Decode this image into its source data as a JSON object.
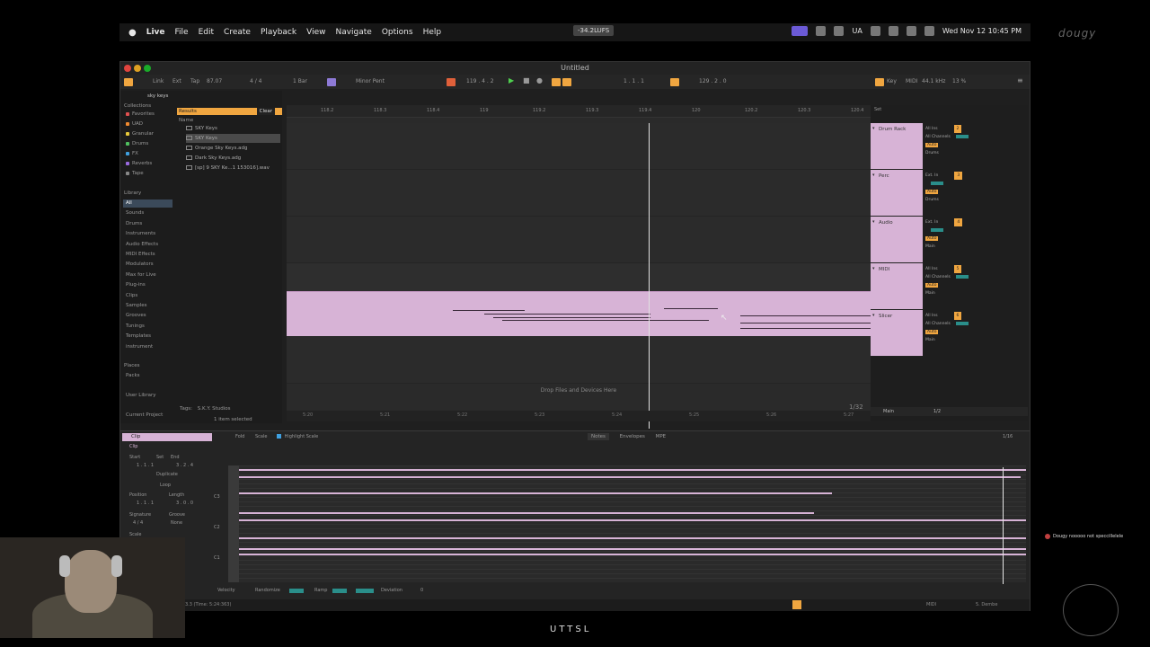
{
  "menubar": {
    "app": "Live",
    "menus": [
      "File",
      "Edit",
      "Create",
      "Playback",
      "View",
      "Navigate",
      "Options",
      "Help"
    ],
    "clock": "Wed Nov 12  10:45 PM",
    "lufs": "-34.2LUFS",
    "tray_ua": "UA"
  },
  "brand": "dougy",
  "window": {
    "title": "Untitled"
  },
  "control": {
    "link": "Link",
    "ext": "Ext",
    "tap": "Tap",
    "tempo": "87.07",
    "time_sig": "4 / 4",
    "bar": "1 Bar",
    "key": "Minor Pent",
    "position": "119 . 4 . 2",
    "loop_start": "1 . 1 . 1",
    "loop_len": "129 . 2 . 0",
    "key_label": "Key",
    "midi_label": "MIDI",
    "sample_rate": "44.1 kHz",
    "cpu": "13 %"
  },
  "browser": {
    "search": "sky keys",
    "results_label": "Results",
    "clear_label": "Clear",
    "name_header": "Name",
    "collections_header": "Collections",
    "collections": [
      {
        "label": "Favorites",
        "color": "#e05050"
      },
      {
        "label": "UAD",
        "color": "#f08a30"
      },
      {
        "label": "Granular",
        "color": "#e8c93a"
      },
      {
        "label": "Drums",
        "color": "#4fbf5f"
      },
      {
        "label": "FX",
        "color": "#3fa0e0"
      },
      {
        "label": "Reverbs",
        "color": "#9a6ae0"
      },
      {
        "label": "Tape",
        "color": "#888888"
      }
    ],
    "library_header": "Library",
    "library": [
      "All",
      "Sounds",
      "Drums",
      "Instruments",
      "Audio Effects",
      "MIDI Effects",
      "Modulators",
      "Max for Live",
      "Plug-ins",
      "Clips",
      "Samples",
      "Grooves",
      "Tunings",
      "Templates",
      "instrument"
    ],
    "places_header": "Places",
    "places": [
      "Packs",
      "User Library",
      "Current Project"
    ],
    "files": [
      "SKY Keys",
      "SKY Keys",
      "Orange Sky Keys.adg",
      "Dark Sky Keys.adg",
      "[sp] 9 SKY Ke...1 153016].wav"
    ],
    "tags_label": "Tags:",
    "tags_value": "S.K.Y. Studios",
    "selected": "1 item selected"
  },
  "arrangement": {
    "ruler": [
      "118.2",
      "118.3",
      "118.4",
      "119",
      "119.2",
      "119.3",
      "119.4",
      "120",
      "120.2",
      "120.3",
      "120.4"
    ],
    "bottom_ruler": [
      "5:20",
      "5:21",
      "5:22",
      "5:23",
      "5:24",
      "5:25",
      "5:26",
      "5:27"
    ],
    "drop_msg": "Drop Files and Devices Here",
    "grid": "1/32"
  },
  "tracks": [
    {
      "name": "Drum Rack",
      "input": "All Ins",
      "channel": "All Channels",
      "monitor": "Auto",
      "out": "Drums",
      "num": "2"
    },
    {
      "name": "Perc",
      "input": "Ext. In",
      "channel": "",
      "monitor": "Auto",
      "out": "Drums",
      "num": "3"
    },
    {
      "name": "Audio",
      "input": "Ext. In",
      "channel": "",
      "monitor": "Auto",
      "out": "Main",
      "num": "4"
    },
    {
      "name": "MIDI",
      "input": "All Ins",
      "channel": "All Channels",
      "monitor": "Auto",
      "out": "Main",
      "num": "5"
    },
    {
      "name": "Slicer",
      "input": "All Ins",
      "channel": "All Channels",
      "monitor": "Auto",
      "out": "Main",
      "num": "6"
    }
  ],
  "main_track": {
    "name": "Main",
    "value": "1/2"
  },
  "set_label": "Set",
  "detail": {
    "clip_label": "Clip",
    "clip_name": "Clip",
    "fold": "Fold",
    "scale": "Scale",
    "highlight": "Highlight Scale",
    "tabs": [
      "Notes",
      "Envelopes",
      "MPE"
    ],
    "start_label": "Start",
    "set_label": "Set",
    "end_label": "End",
    "start_val": "1 . 1 . 1",
    "end_val": "3 . 2 . 4",
    "duplicate": "Duplicate",
    "loop": "Loop",
    "position_label": "Position",
    "length_label": "Length",
    "position_val": "1 . 1 . 1",
    "length_val": "3 . 0 . 0",
    "signature_label": "Signature",
    "groove_label": "Groove",
    "signature_val": "4 / 4",
    "groove_val": "None",
    "scale_label": "Scale",
    "note_labels": [
      "C3",
      "C2",
      "C1"
    ],
    "zoom": "1/16",
    "velocity": "Velocity",
    "randomize": "Randomize",
    "ramp": "Ramp",
    "deviation": "Deviation",
    "deviation_val": "0",
    "status": "3.3 (Time: 5:24:363)"
  },
  "status_right": "MIDI",
  "status_track": "5. Dembe",
  "chat": "Dougy nooooo not speccillelele",
  "bottom_logo": "UTTSL"
}
